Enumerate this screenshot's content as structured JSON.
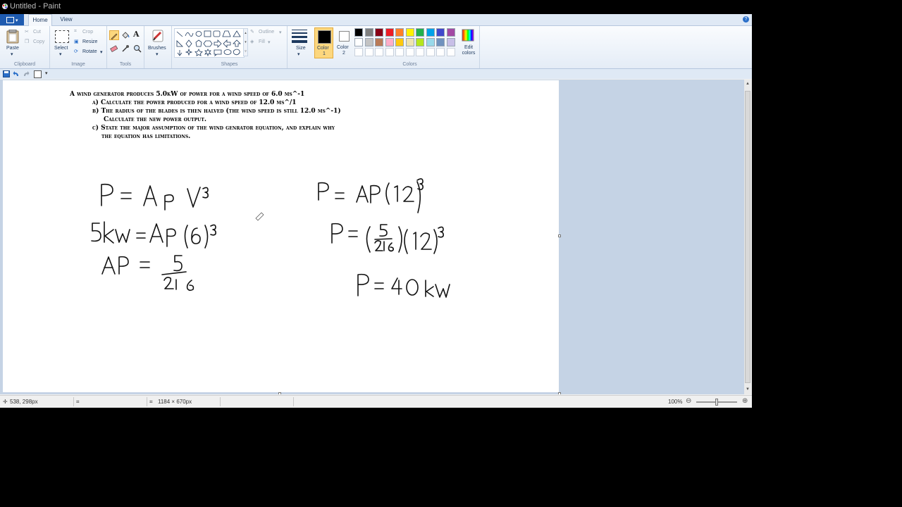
{
  "window": {
    "title": "Untitled - Paint"
  },
  "tabs": [
    {
      "label": "Home"
    },
    {
      "label": "View"
    }
  ],
  "ribbon": {
    "clipboard": {
      "paste": "Paste",
      "cut": "Cut",
      "copy": "Copy",
      "label": "Clipboard"
    },
    "image": {
      "select": "Select",
      "crop": "Crop",
      "resize": "Resize",
      "rotate": "Rotate",
      "label": "Image"
    },
    "tools": {
      "label": "Tools"
    },
    "brushes": {
      "label": "Brushes"
    },
    "shapes": {
      "outline": "Outline",
      "fill": "Fill",
      "label": "Shapes"
    },
    "size": {
      "label": "Size"
    },
    "color1": {
      "label": "Color",
      "num": "1"
    },
    "color2": {
      "label": "Color",
      "num": "2"
    },
    "colors": {
      "label": "Colors",
      "edit": "Edit colors",
      "palette_row1": [
        "#000000",
        "#7f7f7f",
        "#880015",
        "#ed1c24",
        "#ff7f27",
        "#fff200",
        "#22b14c",
        "#00a2e8",
        "#3f48cc",
        "#a349a4"
      ],
      "palette_row2": [
        "#ffffff",
        "#c3c3c3",
        "#b97a57",
        "#ffaec9",
        "#ffc90e",
        "#efe4b0",
        "#b5e61d",
        "#99d9ea",
        "#7092be",
        "#c8bfe7"
      ]
    }
  },
  "problem": {
    "line1": "A wind generator produces 5.0kW of power for a wind speed of 6.0 ms^-1",
    "a": "a) Calculate the power produced for a wind speed of 12.0 ms^/1",
    "b1": "b) The radius of the blades is then halved (the wind speed is still 12.0 ms^-1)",
    "b2": "Calculate the new power output.",
    "c1": "c) State the major assumption of the wind genrator equation, and explain why",
    "c2": "the equation has limitations."
  },
  "status": {
    "cursor_pos": "538, 298px",
    "canvas_size": "1184 × 670px",
    "zoom": "100%"
  }
}
